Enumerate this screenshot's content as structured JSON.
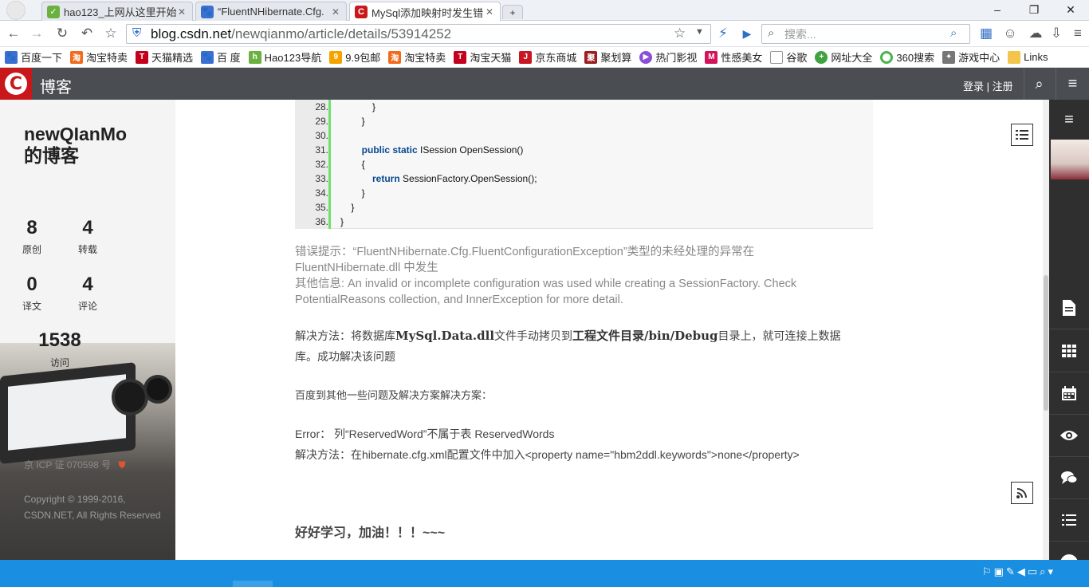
{
  "browser": {
    "tabs": [
      {
        "label": "hao123_上网从这里开始",
        "active": false
      },
      {
        "label": "“FluentNHibernate.Cfg.",
        "active": false
      },
      {
        "label": "MySql添加映射时发生错",
        "active": true
      }
    ],
    "url_host": "blog.csdn.net",
    "url_path": "/newqianmo/article/details/53914252",
    "search_placeholder": "搜索...",
    "bookmarks": [
      "百度一下",
      "淘宝特卖",
      "天猫精选",
      "百 度",
      "Hao123导航",
      "9.9包邮",
      "淘宝特卖",
      "淘宝天猫",
      "京东商城",
      "聚划算",
      "热门影视",
      "性感美女",
      "谷歌",
      "网址大全",
      "360搜索",
      "游戏中心",
      "Links"
    ]
  },
  "header": {
    "logo_letter": "C",
    "site_label": "博客",
    "login": "登录",
    "separator": "|",
    "register": "注册"
  },
  "sidebar": {
    "blog_title_line1": "newQIanMo",
    "blog_title_line2": "的博客",
    "stats": [
      {
        "value": "8",
        "label": "原创"
      },
      {
        "value": "4",
        "label": "转载"
      },
      {
        "value": "0",
        "label": "译文"
      },
      {
        "value": "4",
        "label": "评论"
      }
    ],
    "visits_value": "1538",
    "visits_label": "访问",
    "icp": "京 ICP 证 070598 号",
    "copyright_line1": "Copyright © 1999-2016,",
    "copyright_line2": "CSDN.NET, All Rights Reserved"
  },
  "code": {
    "lines": [
      {
        "no": "28.",
        "text": "            }"
      },
      {
        "no": "29.",
        "text": "        }"
      },
      {
        "no": "30.",
        "text": ""
      },
      {
        "no": "31.",
        "kw": "public static",
        "text": " ISession OpenSession()",
        "indent": "        "
      },
      {
        "no": "32.",
        "text": "        {"
      },
      {
        "no": "33.",
        "kw": "return",
        "text": " SessionFactory.OpenSession();",
        "indent": "            "
      },
      {
        "no": "34.",
        "text": "        }"
      },
      {
        "no": "35.",
        "text": "    }"
      },
      {
        "no": "36.",
        "text": "}"
      }
    ]
  },
  "article": {
    "error_line1": "错误提示：“FluentNHibernate.Cfg.FluentConfigurationException”类型的未经处理的异常在",
    "error_line2": "FluentNHibernate.dll 中发生",
    "error_line3": "其他信息: An invalid or incomplete configuration was used while creating a SessionFactory. Check",
    "error_line4": "PotentialReasons collection, and InnerException for more detail.",
    "solution_prefix": "解决方法：将数据库",
    "solution_bold1": "MySql.Data.dll",
    "solution_mid": "文件手动拷贝到",
    "solution_bold2": "工程文件目录/bin/Debug",
    "solution_suffix": "目录上，就可连接上数据",
    "solution_line2": "库。成功解决该问题",
    "baidu_line": "百度到其他一些问题及解决方案解决方案：",
    "error2": "Error： 列“ReservedWord”不属于表 ReservedWords",
    "solution2": "解决方法：在hibernate.cfg.xml配置文件中加入<property name=\"hbm2ddl.keywords\">none</property>",
    "closing": "好好学习，加油！！！~~~"
  },
  "icons": [
    "menu-icon",
    "search-icon",
    "list-icon",
    "rss-icon",
    "document-icon",
    "grid-icon",
    "calendar-icon",
    "eye-icon",
    "chat-icon",
    "ordered-list-icon"
  ],
  "colors": {
    "csdn_red": "#c9181b",
    "header_bg": "#4a4d52",
    "rail_bg": "#2f2f2f",
    "keyword": "#06488e",
    "taskbar": "#1a8ee0"
  }
}
